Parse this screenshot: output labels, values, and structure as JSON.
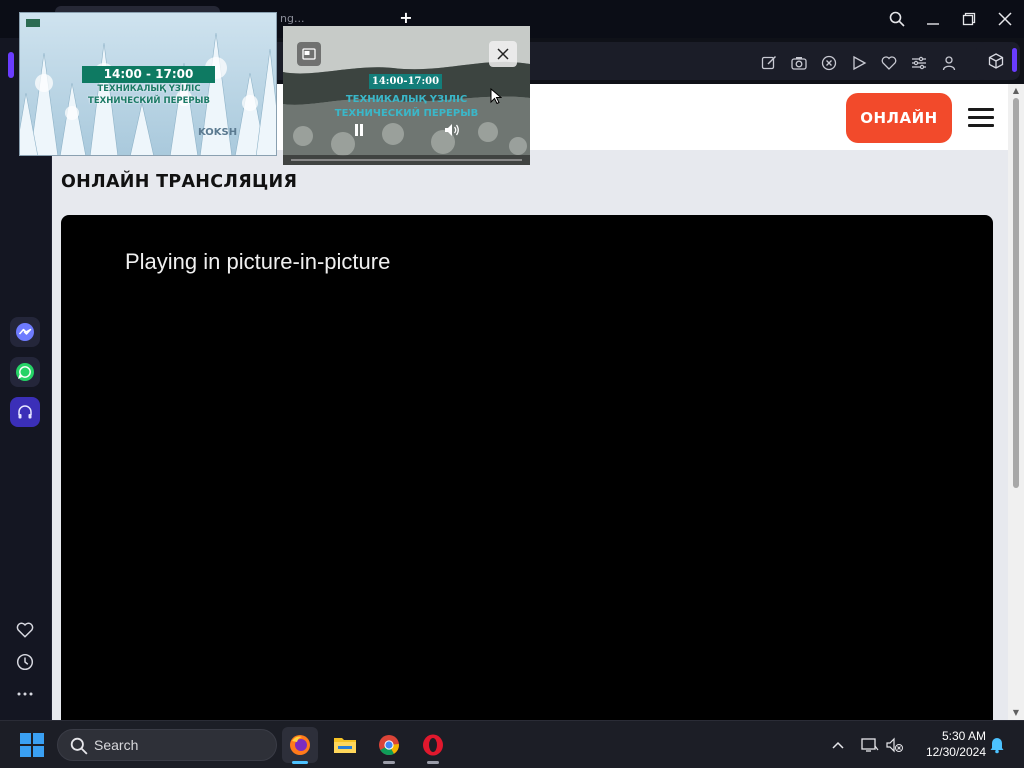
{
  "browser": {
    "tab_partial_text": "ng...",
    "new_tab_symbol": "+",
    "window_controls": [
      "search-icon",
      "minimize-icon",
      "restore-icon",
      "close-icon"
    ],
    "toolbar_icons": [
      "edit-icon",
      "camera-icon",
      "shield-icon",
      "play-icon",
      "heart-icon",
      "settings-icon",
      "account-icon"
    ],
    "accent_color": "#6a3cff"
  },
  "sidebar": {
    "apps": [
      "messenger-icon",
      "whatsapp-icon",
      "music-icon"
    ],
    "bottom_icons": [
      "heart-icon",
      "history-icon",
      "more-icon"
    ]
  },
  "page": {
    "online_button": "ОНЛАЙН",
    "section_title": "ОНЛАЙН ТРАНСЛЯЦИЯ",
    "player_message": "Playing in picture-in-picture",
    "brand_color": "#f24a2b"
  },
  "pip_window_1": {
    "time": "14:00 - 17:00",
    "line1": "ТЕХНИКАЛЫҚ ҮЗІЛІС",
    "line2": "ТЕХНИЧЕСКИЙ ПЕРЕРЫВ",
    "logo": "KOKSH"
  },
  "pip_window_2": {
    "time": "14:00-17:00",
    "line1": "ТЕХНИКАЛЫҚ ҮЗІЛІС",
    "line2": "ТЕХНИЧЕСКИЙ ПЕРЕРЫВ"
  },
  "taskbar": {
    "search_label": "Search",
    "apps": [
      "firefox-icon",
      "file-explorer-icon",
      "chrome-icon",
      "opera-icon"
    ],
    "time": "5:30 AM",
    "date": "12/30/2024"
  }
}
